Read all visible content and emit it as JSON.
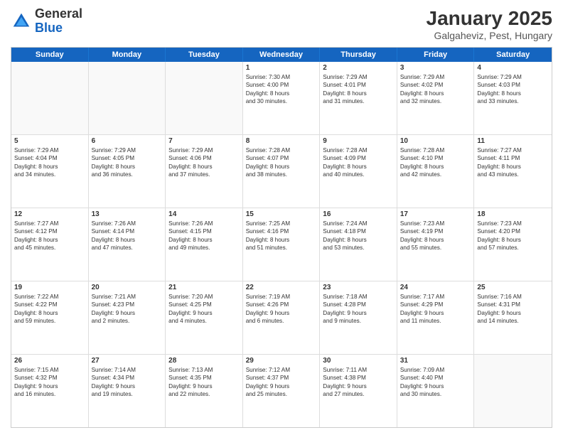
{
  "header": {
    "logo_line1": "General",
    "logo_line2": "Blue",
    "main_title": "January 2025",
    "subtitle": "Galgaheviz, Pest, Hungary"
  },
  "calendar": {
    "days_of_week": [
      "Sunday",
      "Monday",
      "Tuesday",
      "Wednesday",
      "Thursday",
      "Friday",
      "Saturday"
    ],
    "rows": [
      [
        {
          "day": "",
          "empty": true
        },
        {
          "day": "",
          "empty": true
        },
        {
          "day": "",
          "empty": true
        },
        {
          "day": "1",
          "info": "Sunrise: 7:30 AM\nSunset: 4:00 PM\nDaylight: 8 hours\nand 30 minutes."
        },
        {
          "day": "2",
          "info": "Sunrise: 7:29 AM\nSunset: 4:01 PM\nDaylight: 8 hours\nand 31 minutes."
        },
        {
          "day": "3",
          "info": "Sunrise: 7:29 AM\nSunset: 4:02 PM\nDaylight: 8 hours\nand 32 minutes."
        },
        {
          "day": "4",
          "info": "Sunrise: 7:29 AM\nSunset: 4:03 PM\nDaylight: 8 hours\nand 33 minutes."
        }
      ],
      [
        {
          "day": "5",
          "info": "Sunrise: 7:29 AM\nSunset: 4:04 PM\nDaylight: 8 hours\nand 34 minutes."
        },
        {
          "day": "6",
          "info": "Sunrise: 7:29 AM\nSunset: 4:05 PM\nDaylight: 8 hours\nand 36 minutes."
        },
        {
          "day": "7",
          "info": "Sunrise: 7:29 AM\nSunset: 4:06 PM\nDaylight: 8 hours\nand 37 minutes."
        },
        {
          "day": "8",
          "info": "Sunrise: 7:28 AM\nSunset: 4:07 PM\nDaylight: 8 hours\nand 38 minutes."
        },
        {
          "day": "9",
          "info": "Sunrise: 7:28 AM\nSunset: 4:09 PM\nDaylight: 8 hours\nand 40 minutes."
        },
        {
          "day": "10",
          "info": "Sunrise: 7:28 AM\nSunset: 4:10 PM\nDaylight: 8 hours\nand 42 minutes."
        },
        {
          "day": "11",
          "info": "Sunrise: 7:27 AM\nSunset: 4:11 PM\nDaylight: 8 hours\nand 43 minutes."
        }
      ],
      [
        {
          "day": "12",
          "info": "Sunrise: 7:27 AM\nSunset: 4:12 PM\nDaylight: 8 hours\nand 45 minutes."
        },
        {
          "day": "13",
          "info": "Sunrise: 7:26 AM\nSunset: 4:14 PM\nDaylight: 8 hours\nand 47 minutes."
        },
        {
          "day": "14",
          "info": "Sunrise: 7:26 AM\nSunset: 4:15 PM\nDaylight: 8 hours\nand 49 minutes."
        },
        {
          "day": "15",
          "info": "Sunrise: 7:25 AM\nSunset: 4:16 PM\nDaylight: 8 hours\nand 51 minutes."
        },
        {
          "day": "16",
          "info": "Sunrise: 7:24 AM\nSunset: 4:18 PM\nDaylight: 8 hours\nand 53 minutes."
        },
        {
          "day": "17",
          "info": "Sunrise: 7:23 AM\nSunset: 4:19 PM\nDaylight: 8 hours\nand 55 minutes."
        },
        {
          "day": "18",
          "info": "Sunrise: 7:23 AM\nSunset: 4:20 PM\nDaylight: 8 hours\nand 57 minutes."
        }
      ],
      [
        {
          "day": "19",
          "info": "Sunrise: 7:22 AM\nSunset: 4:22 PM\nDaylight: 8 hours\nand 59 minutes."
        },
        {
          "day": "20",
          "info": "Sunrise: 7:21 AM\nSunset: 4:23 PM\nDaylight: 9 hours\nand 2 minutes."
        },
        {
          "day": "21",
          "info": "Sunrise: 7:20 AM\nSunset: 4:25 PM\nDaylight: 9 hours\nand 4 minutes."
        },
        {
          "day": "22",
          "info": "Sunrise: 7:19 AM\nSunset: 4:26 PM\nDaylight: 9 hours\nand 6 minutes."
        },
        {
          "day": "23",
          "info": "Sunrise: 7:18 AM\nSunset: 4:28 PM\nDaylight: 9 hours\nand 9 minutes."
        },
        {
          "day": "24",
          "info": "Sunrise: 7:17 AM\nSunset: 4:29 PM\nDaylight: 9 hours\nand 11 minutes."
        },
        {
          "day": "25",
          "info": "Sunrise: 7:16 AM\nSunset: 4:31 PM\nDaylight: 9 hours\nand 14 minutes."
        }
      ],
      [
        {
          "day": "26",
          "info": "Sunrise: 7:15 AM\nSunset: 4:32 PM\nDaylight: 9 hours\nand 16 minutes."
        },
        {
          "day": "27",
          "info": "Sunrise: 7:14 AM\nSunset: 4:34 PM\nDaylight: 9 hours\nand 19 minutes."
        },
        {
          "day": "28",
          "info": "Sunrise: 7:13 AM\nSunset: 4:35 PM\nDaylight: 9 hours\nand 22 minutes."
        },
        {
          "day": "29",
          "info": "Sunrise: 7:12 AM\nSunset: 4:37 PM\nDaylight: 9 hours\nand 25 minutes."
        },
        {
          "day": "30",
          "info": "Sunrise: 7:11 AM\nSunset: 4:38 PM\nDaylight: 9 hours\nand 27 minutes."
        },
        {
          "day": "31",
          "info": "Sunrise: 7:09 AM\nSunset: 4:40 PM\nDaylight: 9 hours\nand 30 minutes."
        },
        {
          "day": "",
          "empty": true
        }
      ]
    ]
  }
}
